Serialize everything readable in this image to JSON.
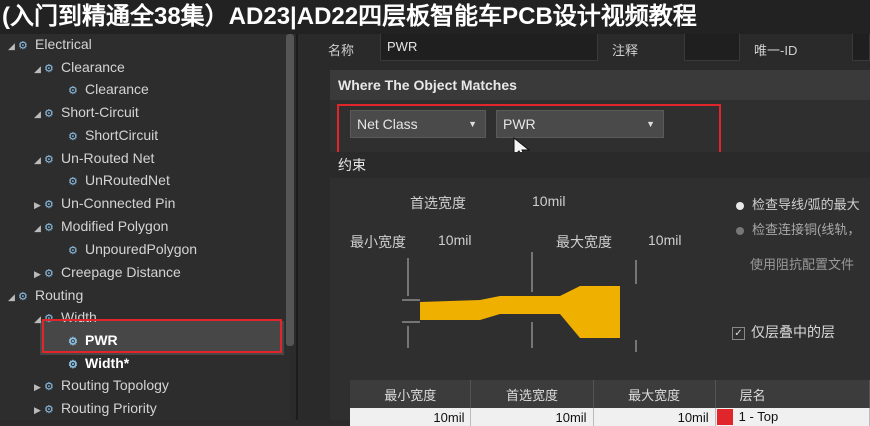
{
  "banner": {
    "title": "(入门到精通全38集）AD23|AD22四层板智能车PCB设计视频教程"
  },
  "tree": {
    "items": [
      {
        "label": "Electrical",
        "level": 0,
        "expanded": true
      },
      {
        "label": "Clearance",
        "level": 1,
        "expanded": true
      },
      {
        "label": "Clearance",
        "level": 2
      },
      {
        "label": "Short-Circuit",
        "level": 1,
        "expanded": true
      },
      {
        "label": "ShortCircuit",
        "level": 2
      },
      {
        "label": "Un-Routed Net",
        "level": 1,
        "expanded": true
      },
      {
        "label": "UnRoutedNet",
        "level": 2
      },
      {
        "label": "Un-Connected Pin",
        "level": 1
      },
      {
        "label": "Modified Polygon",
        "level": 1,
        "expanded": true
      },
      {
        "label": "UnpouredPolygon",
        "level": 2
      },
      {
        "label": "Creepage Distance",
        "level": 1
      },
      {
        "label": "Routing",
        "level": 0,
        "expanded": true
      },
      {
        "label": "Width",
        "level": 1,
        "expanded": true
      },
      {
        "label": "PWR",
        "level": 2,
        "selected": true
      },
      {
        "label": "Width*",
        "level": 2
      },
      {
        "label": "Routing Topology",
        "level": 1
      },
      {
        "label": "Routing Priority",
        "level": 1
      }
    ]
  },
  "props": {
    "name_label": "名称",
    "name_value": "PWR",
    "comment_label": "注释",
    "comment_value": "",
    "uid_label": "唯一-ID",
    "uid_value": ""
  },
  "match": {
    "header": "Where The Object Matches",
    "scope_type": "Net Class",
    "scope_value": "PWR"
  },
  "constraints": {
    "header": "约束",
    "preferred_label": "首选宽度",
    "preferred_value": "10mil",
    "min_label": "最小宽度",
    "min_value": "10mil",
    "max_label": "最大宽度",
    "max_value": "10mil",
    "option1": "检查导线/弧的最大",
    "option2": "检查连接铜(线轨，",
    "impedance": "使用阻抗配置文件",
    "layer_stack_only": "仅层叠中的层"
  },
  "table": {
    "headers": [
      "最小宽度",
      "首选宽度",
      "最大宽度",
      "层名"
    ],
    "row": [
      "10mil",
      "10mil",
      "10mil",
      "1 - Top"
    ]
  },
  "colors": {
    "accent_red": "#e0262a",
    "trace": "#f0b000"
  }
}
